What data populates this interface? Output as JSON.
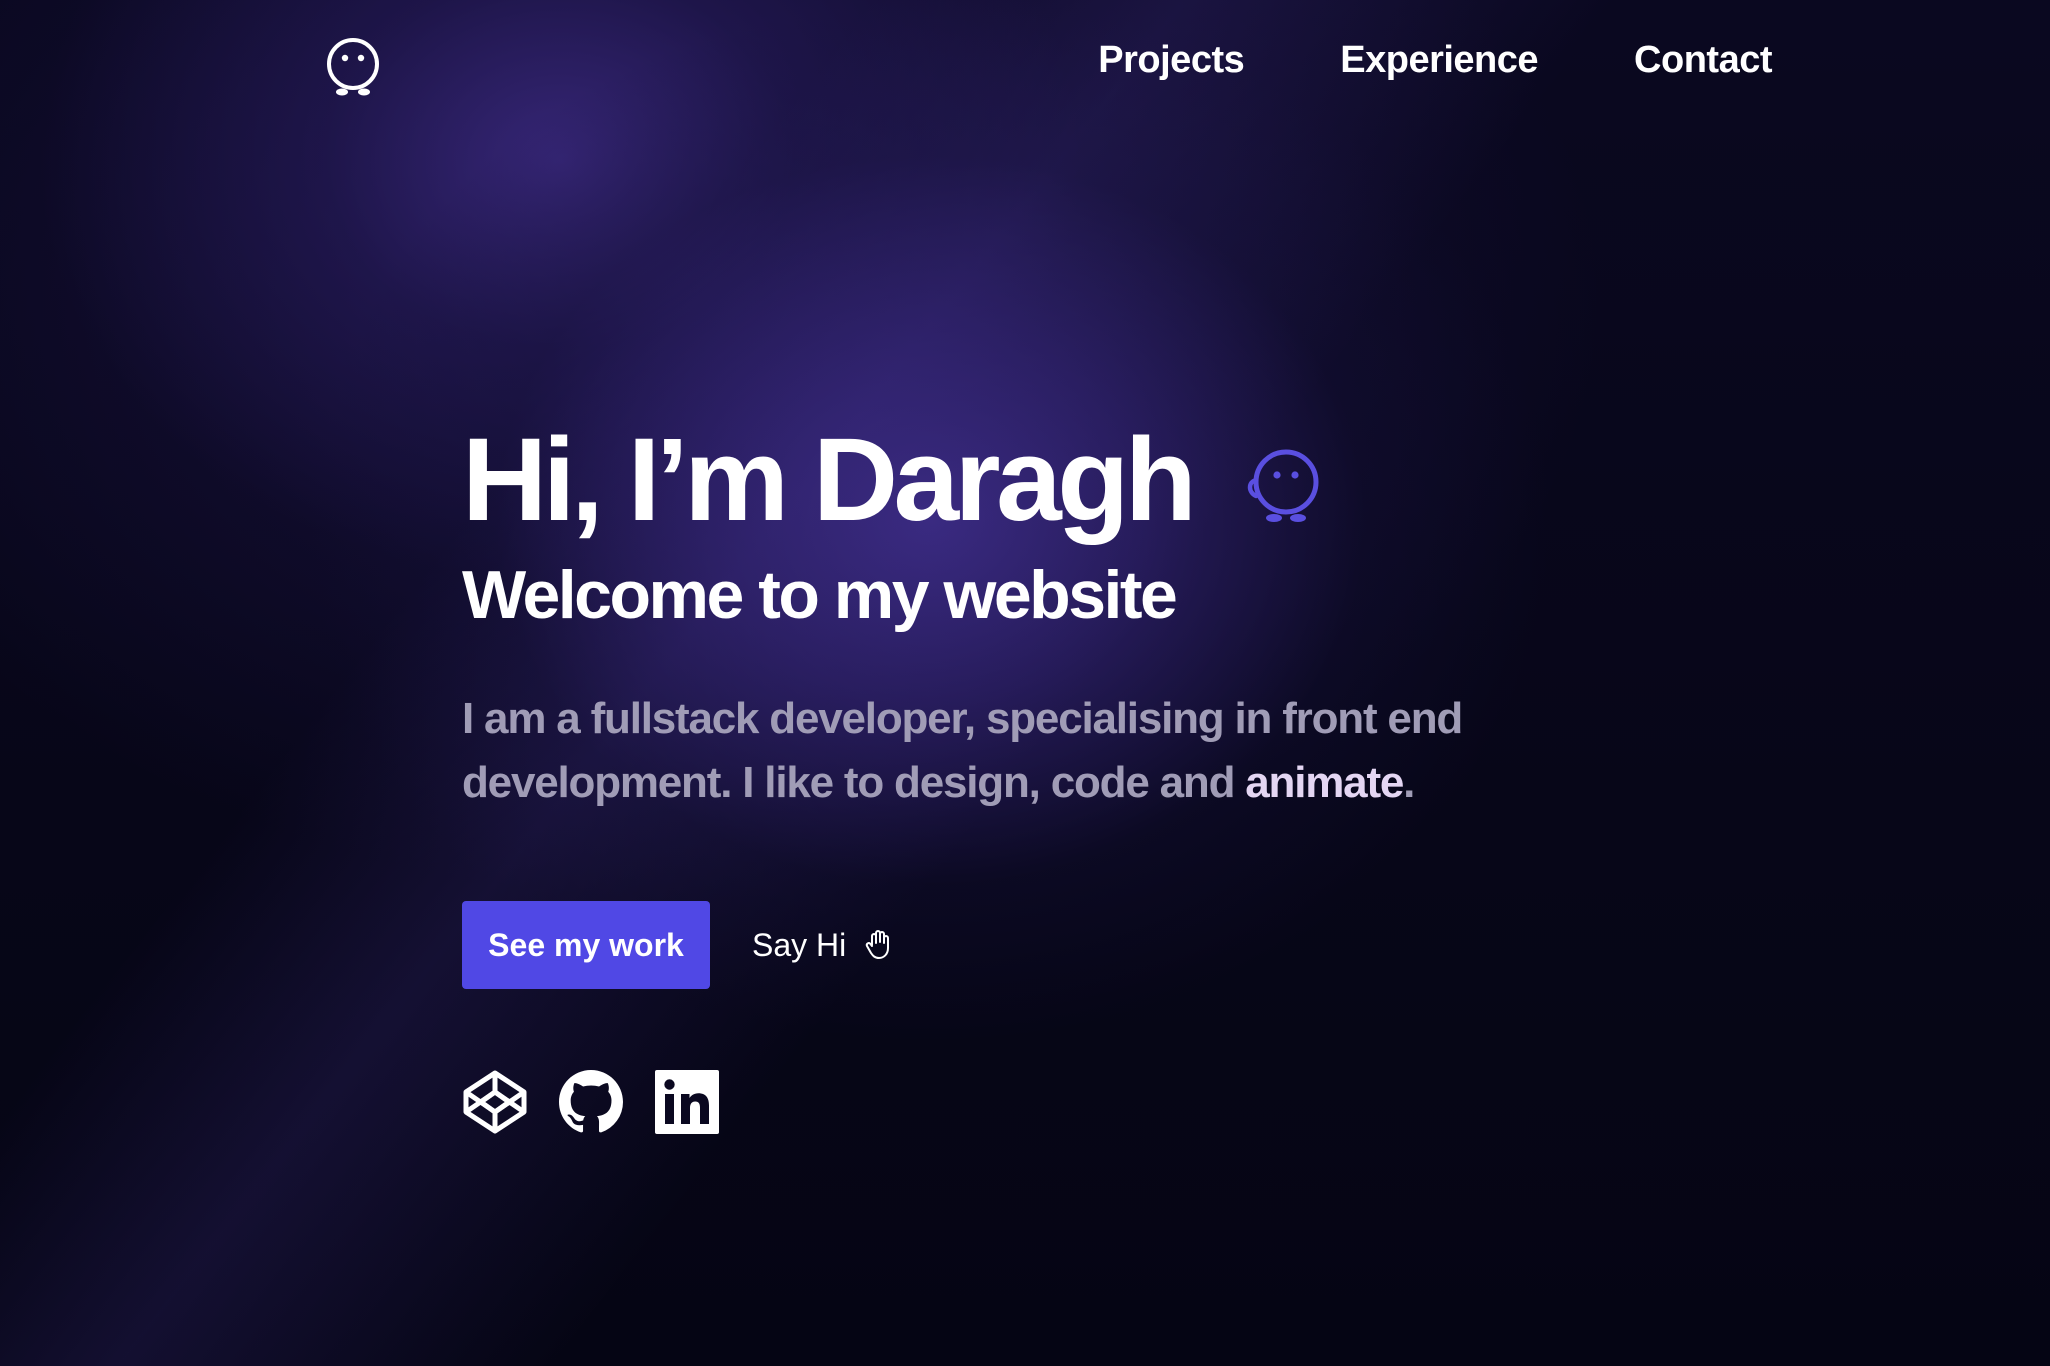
{
  "header": {
    "logo_icon": "mascot-icon",
    "nav": [
      {
        "label": "Projects"
      },
      {
        "label": "Experience"
      },
      {
        "label": "Contact"
      }
    ]
  },
  "hero": {
    "title": "Hi, I’m Daragh",
    "title_icon": "mascot-icon",
    "subtitle": "Welcome to my website",
    "intro_text": "I am a fullstack developer, specialising in front end development. I like to design, code and ",
    "intro_accent": "animate",
    "intro_end": ".",
    "primary_button": "See my work",
    "secondary_link": "Say Hi",
    "secondary_icon": "wave-hand-icon",
    "socials": [
      {
        "icon": "codepen-icon"
      },
      {
        "icon": "github-icon"
      },
      {
        "icon": "linkedin-icon"
      }
    ]
  },
  "colors": {
    "background": "#060616",
    "glow": "#3a2a82",
    "accent_button": "#5048e5",
    "mascot": "#5a4fe0",
    "intro_text": "#a09cb6",
    "intro_accent": "#e4d6f3"
  }
}
